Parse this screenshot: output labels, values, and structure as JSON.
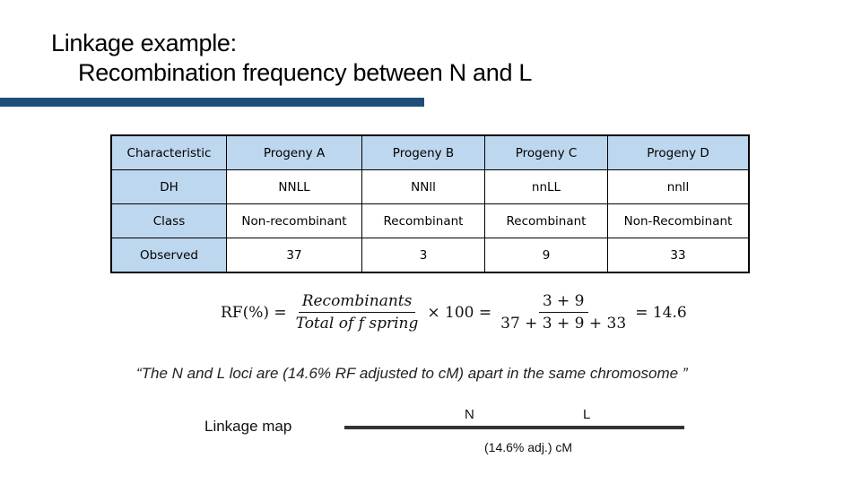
{
  "title": {
    "line1": "Linkage example:",
    "line2": "Recombination frequency between N and L"
  },
  "colors": {
    "accent_bar": "#1f4e79",
    "header_fill": "#bdd7ee"
  },
  "table": {
    "headers": [
      "Characteristic",
      "Progeny A",
      "Progeny B",
      "Progeny C",
      "Progeny D"
    ],
    "rows": [
      {
        "label": "DH",
        "cells": [
          "NNLL",
          "NNll",
          "nnLL",
          "nnll"
        ]
      },
      {
        "label": "Class",
        "cells": [
          "Non-recombinant",
          "Recombinant",
          "Recombinant",
          "Non-Recombinant"
        ]
      },
      {
        "label": "Observed",
        "cells": [
          "37",
          "3",
          "9",
          "33"
        ]
      }
    ]
  },
  "formula": {
    "lhs": "RF(%) =",
    "frac1_num": "Recombinants",
    "frac1_den": "Total of f spring",
    "times": "× 100 =",
    "frac2_num": "3 + 9",
    "frac2_den": "37 + 3 + 9 + 33",
    "result": "= 14.6"
  },
  "quote": "“The N and L loci are (14.6% RF adjusted to cM) apart in the same chromosome ”",
  "linkage_map": {
    "label": "Linkage map",
    "locus_1": "N",
    "locus_2": "L",
    "distance": "(14.6% adj.) cM"
  }
}
